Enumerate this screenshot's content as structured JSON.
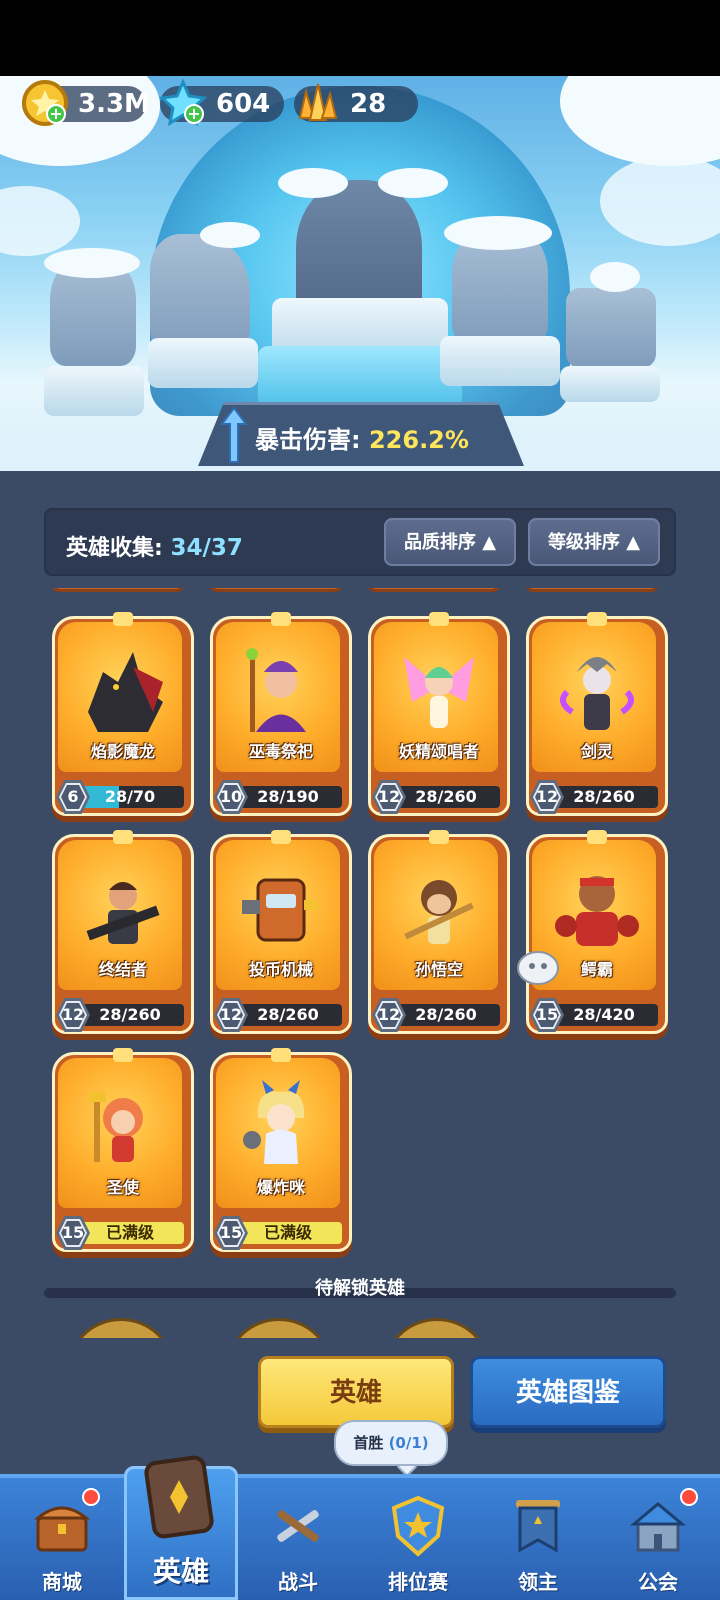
{
  "resources": {
    "gold": "3.3M",
    "diamonds": "604",
    "crystals": "28"
  },
  "crit": {
    "label": "暴击伤害:",
    "value": "226.2%"
  },
  "collection": {
    "label": "英雄收集:",
    "count": "34/37",
    "sort_quality": "品质排序",
    "sort_level": "等级排序"
  },
  "heroes": [
    {
      "name": "焰影魔龙",
      "level": "6",
      "progress": "28/70",
      "fill": 0.4
    },
    {
      "name": "巫毒祭祀",
      "level": "10",
      "progress": "28/190",
      "fill": 0
    },
    {
      "name": "妖精颂唱者",
      "level": "12",
      "progress": "28/260",
      "fill": 0
    },
    {
      "name": "剑灵",
      "level": "12",
      "progress": "28/260",
      "fill": 0
    },
    {
      "name": "终结者",
      "level": "12",
      "progress": "28/260",
      "fill": 0
    },
    {
      "name": "投币机械",
      "level": "12",
      "progress": "28/260",
      "fill": 0
    },
    {
      "name": "孙悟空",
      "level": "12",
      "progress": "28/260",
      "fill": 0
    },
    {
      "name": "鳄霸",
      "level": "15",
      "progress": "28/420",
      "fill": 0
    },
    {
      "name": "圣使",
      "level": "15",
      "progress": "已满级",
      "fill": 1
    },
    {
      "name": "爆炸咪",
      "level": "15",
      "progress": "已满级",
      "fill": 1
    }
  ],
  "locked_section": "待解锁英雄",
  "tabs": {
    "hero": "英雄",
    "dex": "英雄图鉴"
  },
  "tooltip": {
    "label": "首胜",
    "progress": "(0/1)"
  },
  "nav": {
    "shop": "商城",
    "hero": "英雄",
    "battle": "战斗",
    "ranked": "排位赛",
    "lord": "领主",
    "guild": "公会"
  }
}
